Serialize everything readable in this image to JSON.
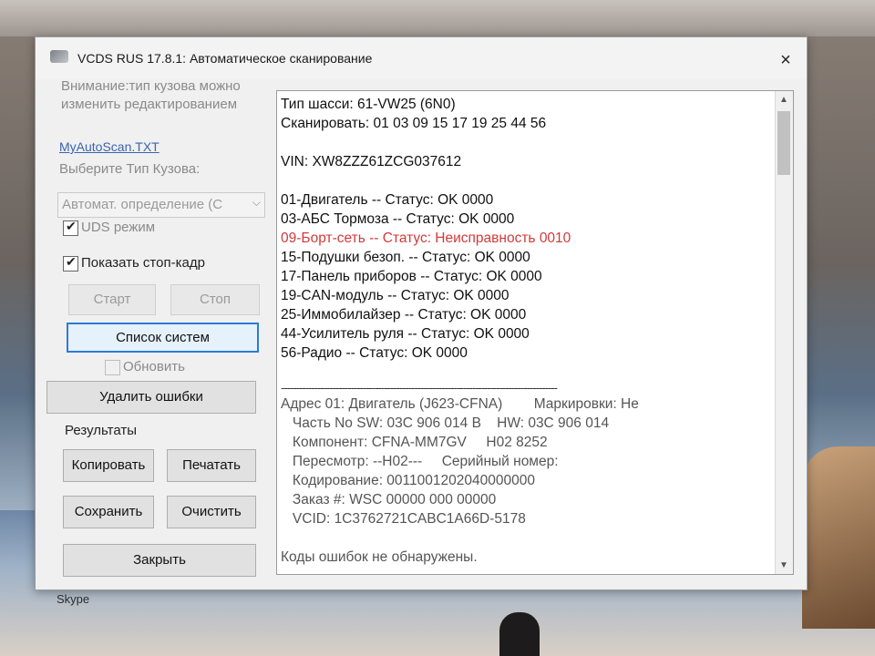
{
  "window": {
    "title": "VCDS RUS 17.8.1:  Автоматическое сканирование",
    "close_label": "×"
  },
  "left": {
    "note": "Внимание:тип кузова можно изменить редактированием",
    "link": "MyAutoScan.TXT",
    "select_type_label": "Выберите Тип Кузова:",
    "combo_value": "Автомат. определение (С",
    "uds_label": "UDS режим",
    "freeze_label": "Показать стоп-кадр",
    "start_label": "Старт",
    "stop_label": "Стоп",
    "systems_label": "Список систем",
    "refresh_label": "Обновить",
    "clear_errors_label": "Удалить ошибки",
    "results_label": "Результаты",
    "copy_label": "Копировать",
    "print_label": "Печатать",
    "save_label": "Сохранить",
    "clear_label": "Очистить",
    "close_label": "Закрыть"
  },
  "output": {
    "chassis": "Тип шасси: 61-VW25 (6N0)",
    "scan": "Сканировать: 01 03 09 15 17 19 25 44 56",
    "vin": "VIN: XW8ZZZ61ZCG037612",
    "modules": [
      "01-Двигатель -- Статус: OK 0000",
      "03-АБС Тормоза -- Статус: OK 0000",
      "09-Борт-сеть -- Статус: Неисправность 0010",
      "15-Подушки безоп. -- Статус: OK 0000",
      "17-Панель приборов -- Статус: OK 0000",
      "19-CAN-модуль -- Статус: OK 0000",
      "25-Иммобилайзер -- Статус: OK 0000",
      "44-Усилитель руля -- Статус: OK 0000",
      "56-Радио -- Статус: OK 0000"
    ],
    "separator": "-------------------------------------------------------------------------------------------",
    "address": "Адрес 01: Двигатель (J623-CFNA)        Маркировки: Не",
    "details": [
      "   Часть No SW: 03C 906 014 B    HW: 03C 906 014",
      "   Компонент: CFNA-MM7GV     H02 8252",
      "   Пересмотр: --H02---     Серийный номер:",
      "   Кодирование: 0011001202040000000",
      "   Заказ #: WSC 00000 000 00000",
      "   VCID: 1C3762721CABC1A66D-5178"
    ],
    "no_errors": "Коды ошибок не обнаружены."
  },
  "desktop": {
    "skype_label": "Skype"
  },
  "colors": {
    "fault_text": "#d13a3a",
    "focus_border": "#2c7bd6"
  }
}
